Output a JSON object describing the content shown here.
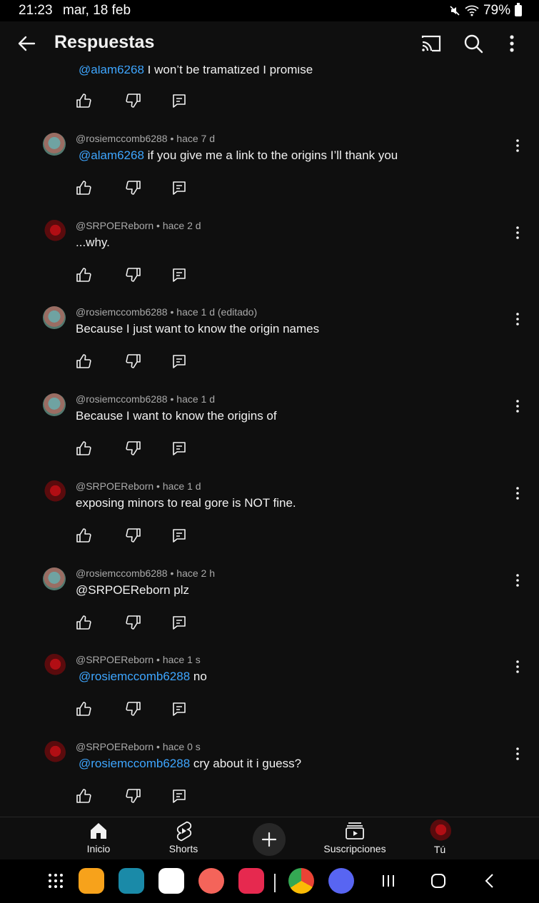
{
  "status": {
    "time": "21:23",
    "date": "mar, 18 feb",
    "battery": "79%"
  },
  "appbar": {
    "title": "Respuestas"
  },
  "top_comment": {
    "mention": "@alam6268",
    "text": " I won’t be tramatized I promise"
  },
  "comments": [
    {
      "avatar": "rosie",
      "meta": "@rosiemccomb6288 • hace 7 d",
      "mention": "@alam6268",
      "text": " if you give me a link to the origins I’ll thank you"
    },
    {
      "avatar": "srp",
      "meta": "@SRPOEReborn • hace 2 d",
      "mention": "",
      "text": "...why."
    },
    {
      "avatar": "rosie",
      "meta": "@rosiemccomb6288 • hace 1 d (editado)",
      "mention": "",
      "text": "Because I just want to know the origin names"
    },
    {
      "avatar": "rosie",
      "meta": "@rosiemccomb6288 • hace 1 d",
      "mention": "",
      "text": "Because I want to know the origins of"
    },
    {
      "avatar": "srp",
      "meta": "@SRPOEReborn • hace 1 d",
      "mention": "",
      "text": "exposing minors to real gore is NOT fine."
    },
    {
      "avatar": "rosie",
      "meta": "@rosiemccomb6288 • hace 2 h",
      "mention": "",
      "text": "@SRPOEReborn plz"
    },
    {
      "avatar": "srp",
      "meta": "@SRPOEReborn • hace 1 s",
      "mention": "@rosiemccomb6288",
      "text": "  no"
    },
    {
      "avatar": "srp",
      "meta": "@SRPOEReborn • hace 0 s",
      "mention": "@rosiemccomb6288",
      "text": "  cry about it i guess?"
    }
  ],
  "bottom_nav": {
    "home": "Inicio",
    "shorts": "Shorts",
    "subscriptions": "Suscripciones",
    "you": "Tú"
  },
  "icons": [
    "back-arrow-icon",
    "cast-icon",
    "search-icon",
    "more-vert-icon",
    "thumb-up-icon",
    "thumb-down-icon",
    "reply-icon",
    "home-icon",
    "shorts-icon",
    "create-icon",
    "subscriptions-icon"
  ],
  "colors": {
    "background": "#0f0f0f",
    "mention": "#3ea6ff",
    "meta": "#aaaaaa"
  }
}
